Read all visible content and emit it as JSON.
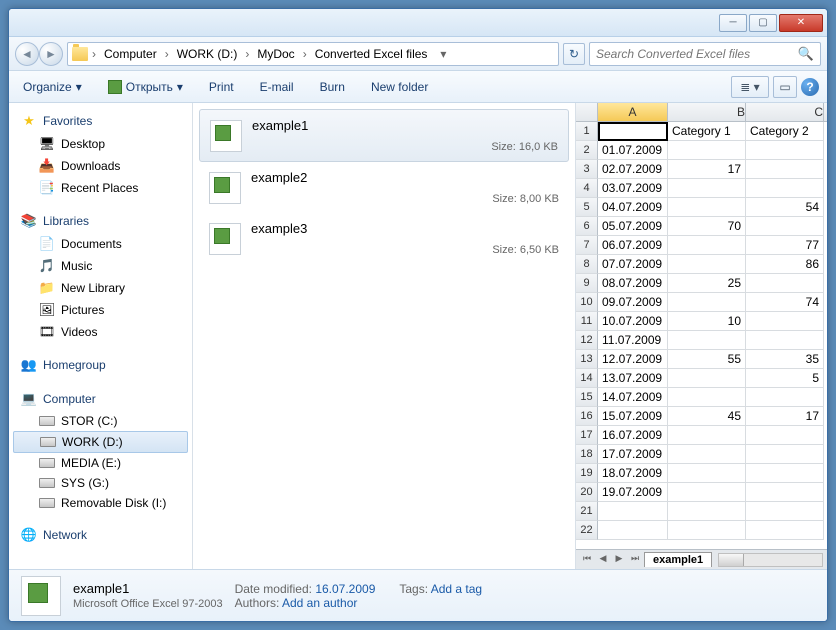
{
  "breadcrumb": [
    "Computer",
    "WORK (D:)",
    "MyDoc",
    "Converted Excel files"
  ],
  "search": {
    "placeholder": "Search Converted Excel files"
  },
  "toolbar": {
    "organize": "Organize",
    "open": "Открыть",
    "print": "Print",
    "email": "E-mail",
    "burn": "Burn",
    "newfolder": "New folder"
  },
  "nav": {
    "favorites": {
      "label": "Favorites",
      "items": [
        "Desktop",
        "Downloads",
        "Recent Places"
      ]
    },
    "libraries": {
      "label": "Libraries",
      "items": [
        "Documents",
        "Music",
        "New Library",
        "Pictures",
        "Videos"
      ]
    },
    "homegroup": "Homegroup",
    "computer": {
      "label": "Computer",
      "items": [
        "STOR (C:)",
        "WORK (D:)",
        "MEDIA (E:)",
        "SYS (G:)",
        "Removable Disk (I:)"
      ]
    },
    "network": "Network"
  },
  "files": [
    {
      "name": "example1",
      "size": "Size: 16,0 KB",
      "selected": true
    },
    {
      "name": "example2",
      "size": "Size: 8,00 KB",
      "selected": false
    },
    {
      "name": "example3",
      "size": "Size: 6,50 KB",
      "selected": false
    }
  ],
  "cols": [
    "A",
    "B",
    "C"
  ],
  "sheet": {
    "headers": [
      "",
      "Category 1",
      "Category 2"
    ],
    "rows": [
      [
        "01.07.2009",
        "",
        ""
      ],
      [
        "02.07.2009",
        "17",
        ""
      ],
      [
        "03.07.2009",
        "",
        ""
      ],
      [
        "04.07.2009",
        "",
        "54"
      ],
      [
        "05.07.2009",
        "70",
        ""
      ],
      [
        "06.07.2009",
        "",
        "77"
      ],
      [
        "07.07.2009",
        "",
        "86"
      ],
      [
        "08.07.2009",
        "25",
        ""
      ],
      [
        "09.07.2009",
        "",
        "74"
      ],
      [
        "10.07.2009",
        "10",
        ""
      ],
      [
        "11.07.2009",
        "",
        ""
      ],
      [
        "12.07.2009",
        "55",
        "35"
      ],
      [
        "13.07.2009",
        "",
        "5"
      ],
      [
        "14.07.2009",
        "",
        ""
      ],
      [
        "15.07.2009",
        "45",
        "17"
      ],
      [
        "16.07.2009",
        "",
        ""
      ],
      [
        "17.07.2009",
        "",
        ""
      ],
      [
        "18.07.2009",
        "",
        ""
      ],
      [
        "19.07.2009",
        "",
        ""
      ],
      [
        "",
        "",
        ""
      ],
      [
        "",
        "",
        ""
      ]
    ],
    "tab": "example1"
  },
  "details": {
    "name": "example1",
    "type": "Microsoft Office Excel 97-2003",
    "modlabel": "Date modified:",
    "mod": "16.07.2009",
    "authlabel": "Authors:",
    "auth": "Add an author",
    "tagslabel": "Tags:",
    "tags": "Add a tag"
  }
}
